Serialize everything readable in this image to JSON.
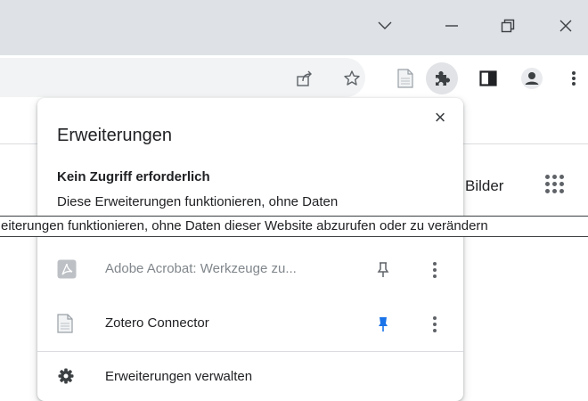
{
  "window": {
    "controls": [
      "chevron-down",
      "minimize",
      "restore",
      "close"
    ]
  },
  "toolbar": {
    "icons": [
      "share-icon",
      "bookmark-star-icon",
      "zotero-document-icon",
      "extensions-puzzle-icon",
      "side-panel-icon",
      "profile-avatar-icon",
      "kebab-menu-icon"
    ]
  },
  "page": {
    "images_link": "Bilder"
  },
  "extensions_popup": {
    "title": "Erweiterungen",
    "close_label": "×",
    "section": {
      "heading": "Kein Zugriff erforderlich",
      "description": "Diese Erweiterungen funktionieren, ohne Daten"
    },
    "items": [
      {
        "name": "Adobe Acrobat: Werkzeuge zu...",
        "pinned": false,
        "icon": "adobe-acrobat-icon"
      },
      {
        "name": "Zotero Connector",
        "pinned": true,
        "icon": "zotero-document-icon"
      }
    ],
    "manage_label": "Erweiterungen verwalten"
  },
  "tooltip": {
    "text": "eiterungen funktionieren, ohne Daten dieser Website abzurufen oder zu verändern"
  },
  "colors": {
    "titlebar": "#dee1e6",
    "pin_active": "#1a73e8",
    "icon_gray": "#5f6368"
  }
}
